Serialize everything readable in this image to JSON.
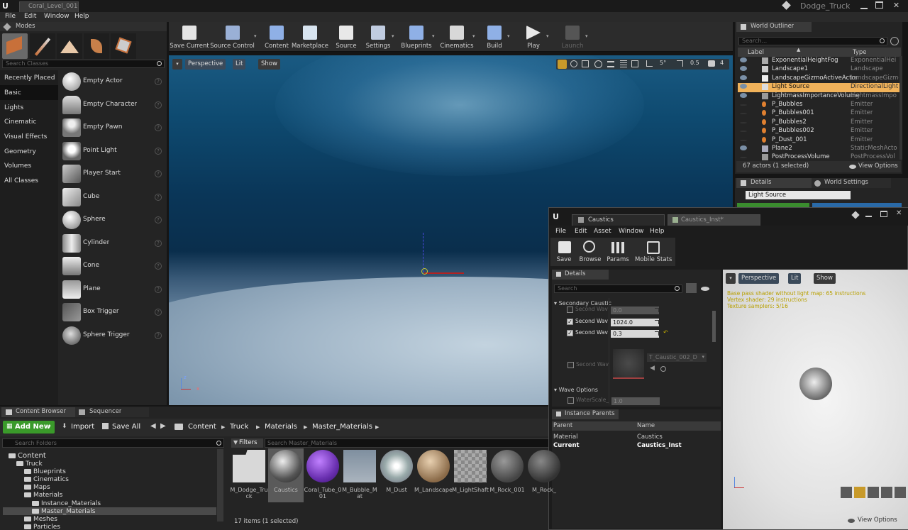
{
  "app": {
    "title_tab": "Coral_Level_001*",
    "project": "Dodge_Truck",
    "menu": [
      "File",
      "Edit",
      "Window",
      "Help"
    ]
  },
  "modes": {
    "tab": "Modes",
    "search_placeholder": "Search Classes",
    "categories": [
      "Recently Placed",
      "Basic",
      "Lights",
      "Cinematic",
      "Visual Effects",
      "Geometry",
      "Volumes",
      "All Classes"
    ],
    "selected_category": "Basic",
    "classes": [
      "Empty Actor",
      "Empty Character",
      "Empty Pawn",
      "Point Light",
      "Player Start",
      "Cube",
      "Sphere",
      "Cylinder",
      "Cone",
      "Plane",
      "Box Trigger",
      "Sphere Trigger"
    ]
  },
  "toolbar": {
    "buttons": [
      "Save Current",
      "Source Control",
      "Content",
      "Marketplace",
      "Source",
      "Settings",
      "Blueprints",
      "Cinematics",
      "Build",
      "Play",
      "Launch"
    ]
  },
  "viewport": {
    "buttons": [
      "Perspective",
      "Lit",
      "Show"
    ],
    "angle": "5°",
    "scale": "0.5",
    "camera_speed": "4"
  },
  "outliner": {
    "tab": "World Outliner",
    "search_placeholder": "Search...",
    "col_label": "Label",
    "col_type": "Type",
    "rows": [
      {
        "label": "ExponentialHeightFog",
        "type": "ExponentialHei",
        "eye": true,
        "icon": "fog"
      },
      {
        "label": "Landscape1",
        "type": "Landscape",
        "eye": true,
        "icon": "landscape"
      },
      {
        "label": "LandscapeGizmoActiveActor",
        "type": "LandscapeGizmo",
        "eye": true,
        "icon": "gizmo"
      },
      {
        "label": "Light Source",
        "type": "DirectionalLight",
        "eye": true,
        "icon": "light",
        "selected": true
      },
      {
        "label": "LightmassImportanceVolume",
        "type": "LightmassImpo",
        "eye": true,
        "icon": "volume"
      },
      {
        "label": "P_Bubbles",
        "type": "Emitter",
        "eye": false,
        "icon": "emitter"
      },
      {
        "label": "P_Bubbles001",
        "type": "Emitter",
        "eye": false,
        "icon": "emitter"
      },
      {
        "label": "P_Bubbles2",
        "type": "Emitter",
        "eye": false,
        "icon": "emitter"
      },
      {
        "label": "P_Bubbles002",
        "type": "Emitter",
        "eye": false,
        "icon": "emitter"
      },
      {
        "label": "P_Dust_001",
        "type": "Emitter",
        "eye": false,
        "icon": "emitter"
      },
      {
        "label": "Plane2",
        "type": "StaticMeshActo",
        "eye": true,
        "icon": "mesh"
      },
      {
        "label": "PostProcessVolume",
        "type": "PostProcessVol",
        "eye": false,
        "icon": "volume"
      }
    ],
    "status": "67 actors (1 selected)",
    "view_options": "View Options"
  },
  "details_panel": {
    "tab_details": "Details",
    "tab_world": "World Settings",
    "name_value": "Light Source"
  },
  "material_editor": {
    "tabs": [
      "Caustics",
      "Caustics_Inst*"
    ],
    "menu": [
      "File",
      "Edit",
      "Asset",
      "Window",
      "Help"
    ],
    "toolbar": [
      "Save",
      "Browse",
      "Params",
      "Mobile Stats"
    ],
    "details_tab": "Details",
    "search_placeholder": "Search",
    "section_secondary": "Secondary Caustic",
    "params": [
      {
        "label": "Second Wave",
        "value": "0.0",
        "checked": false
      },
      {
        "label": "Second Wave",
        "value": "1024.0",
        "checked": true
      },
      {
        "label": "Second Wave",
        "value": "0.3",
        "checked": true
      }
    ],
    "texture_param": {
      "label": "Second Wave",
      "value": "T_Caustic_002_D"
    },
    "section_wave": "Wave Options",
    "wave_param": {
      "label": "WaterScale_",
      "value": "1.0"
    },
    "instance_parents_tab": "Instance Parents",
    "ip_col_parent": "Parent",
    "ip_col_name": "Name",
    "ip_rows": [
      {
        "parent": "Material",
        "name": "Caustics"
      },
      {
        "parent": "Current",
        "name": "Caustics_Inst"
      }
    ],
    "preview_buttons": [
      "Perspective",
      "Lit",
      "Show"
    ],
    "stats": [
      "Base pass shader without light map: 65 instructions",
      "Vertex shader: 29 instructions",
      "Texture samplers: 5/16"
    ],
    "view_options": "View Options"
  },
  "content_browser": {
    "tab": "Content Browser",
    "tab2": "Sequencer",
    "add_new": "Add New",
    "import": "Import",
    "save_all": "Save All",
    "breadcrumbs": [
      "Content",
      "Truck",
      "Materials",
      "Master_Materials"
    ],
    "search_folders": "Search Folders",
    "filters": "Filters",
    "search_assets": "Search Master_Materials",
    "tree": [
      {
        "label": "Content",
        "depth": 0
      },
      {
        "label": "Truck",
        "depth": 1
      },
      {
        "label": "Blueprints",
        "depth": 2
      },
      {
        "label": "Cinematics",
        "depth": 2
      },
      {
        "label": "Maps",
        "depth": 2
      },
      {
        "label": "Materials",
        "depth": 2
      },
      {
        "label": "Instance_Materials",
        "depth": 3
      },
      {
        "label": "Master_Materials",
        "depth": 3,
        "selected": true
      },
      {
        "label": "Meshes",
        "depth": 2
      },
      {
        "label": "Particles",
        "depth": 2
      }
    ],
    "assets": [
      "M_Dodge_Truck",
      "Caustics",
      "Coral_Tube_001",
      "M_Bubble_Mat",
      "M_Dust",
      "M_Landscape",
      "M_LightShaft",
      "M_Rock_001",
      "M_Rock_"
    ],
    "status": "17 items (1 selected)"
  }
}
